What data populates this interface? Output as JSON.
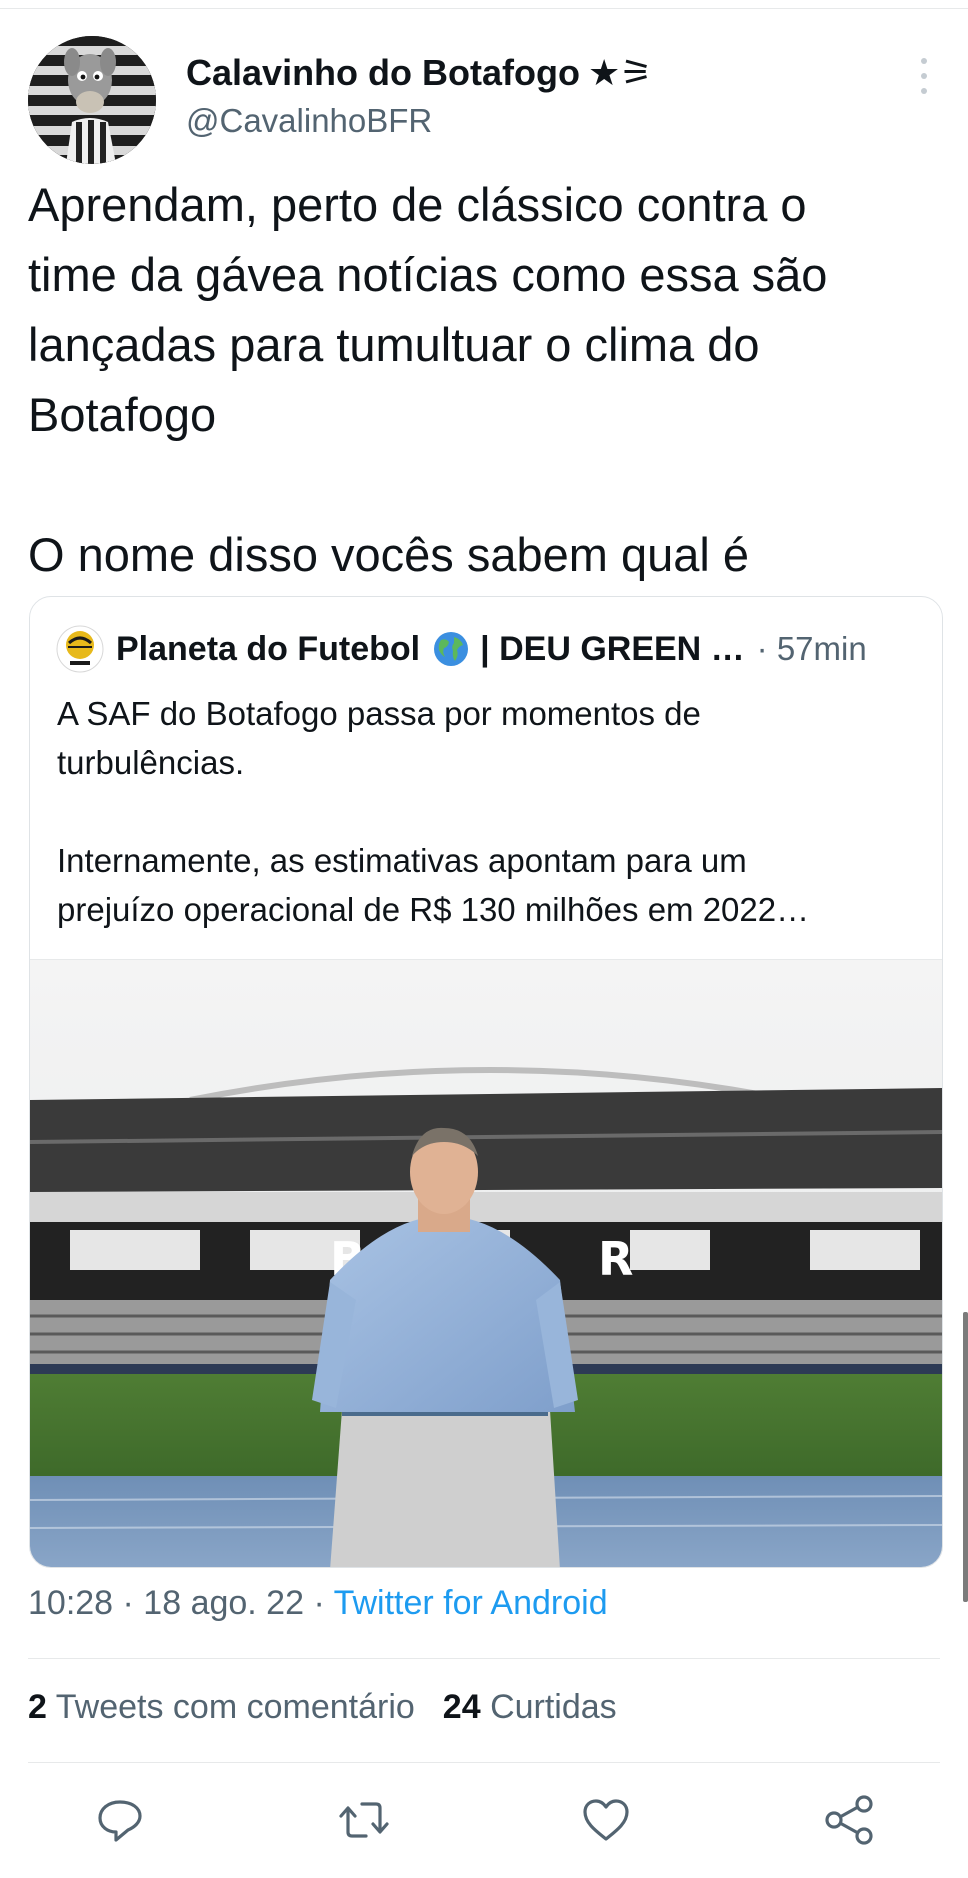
{
  "author": {
    "name": "Calavinho do Botafogo",
    "badge": "★⚞",
    "handle": "@CavalinhoBFR"
  },
  "tweet": {
    "text": "Aprendam, perto de clássico contra o\ntime da gávea notícias como essa são\nlançadas para tumultuar o clima do\nBotafogo\n\nO nome disso vocês sabem qual é"
  },
  "quoted": {
    "name": "Planeta do Futebol",
    "name_suffix": "| DEU GREEN …",
    "time": "· 57min",
    "text": "A SAF do Botafogo passa por momentos de\nturbulências.\n\nInternamente, as estimativas apontam para um\nprejuízo operacional de R$ 130 milhões em 2022…"
  },
  "meta": {
    "time_date": "10:28 · 18 ago. 22 · ",
    "source": "Twitter for Android"
  },
  "stats": {
    "quotes_count": "2",
    "quotes_label": "Tweets com comentário",
    "likes_count": "24",
    "likes_label": "Curtidas"
  },
  "icons": {
    "reply": "reply-icon",
    "retweet": "retweet-icon",
    "like": "heart-icon",
    "share": "share-icon",
    "globe": "globe-icon",
    "more": "more-options-icon"
  },
  "colors": {
    "text_primary": "#0f1419",
    "text_secondary": "#536471",
    "link": "#1d9bf0",
    "border": "#e7e9ea"
  }
}
